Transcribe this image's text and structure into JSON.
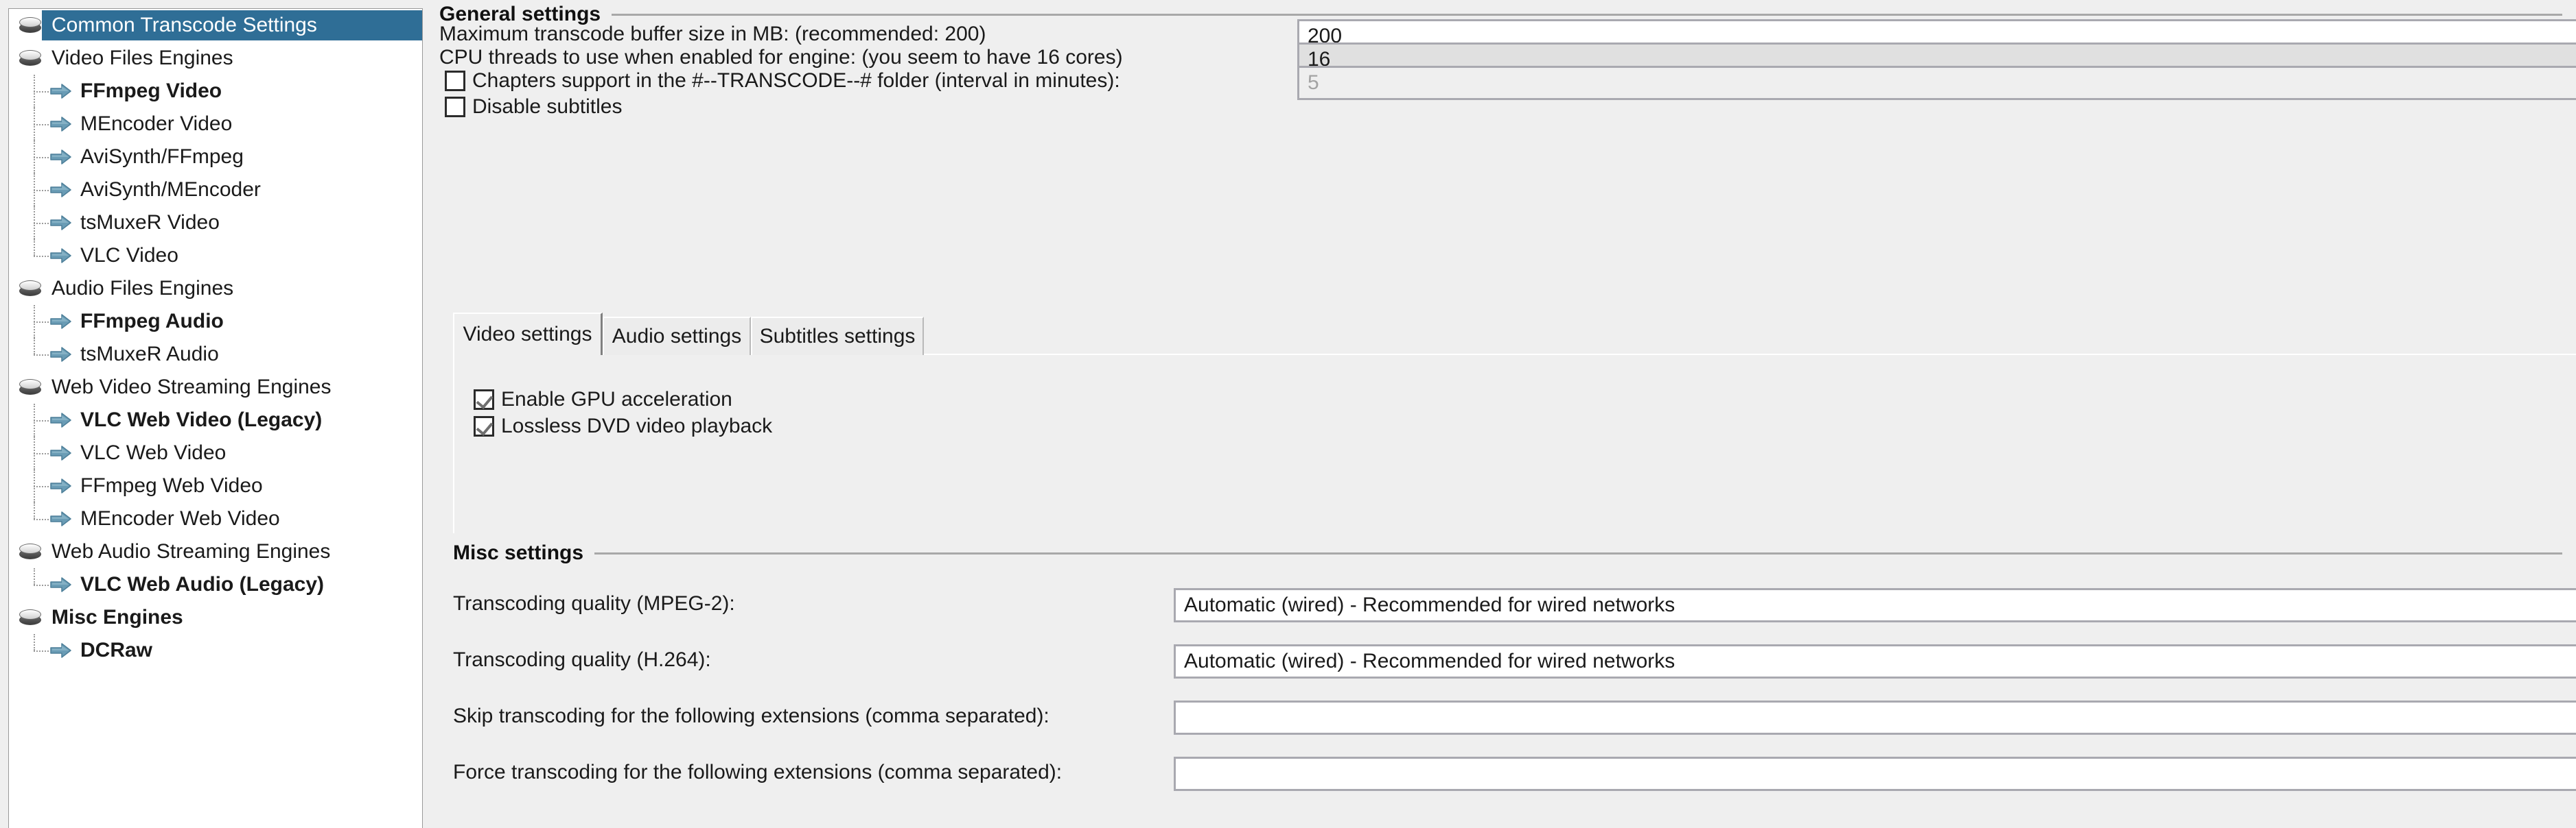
{
  "tree": {
    "items": [
      {
        "label": "Common Transcode Settings",
        "type": "category",
        "bold": false,
        "selected": true
      },
      {
        "label": "Video Files Engines",
        "type": "category",
        "bold": false,
        "selected": false
      },
      {
        "label": "FFmpeg Video",
        "type": "leaf",
        "bold": true,
        "selected": false
      },
      {
        "label": "MEncoder Video",
        "type": "leaf",
        "bold": false,
        "selected": false
      },
      {
        "label": "AviSynth/FFmpeg",
        "type": "leaf",
        "bold": false,
        "selected": false
      },
      {
        "label": "AviSynth/MEncoder",
        "type": "leaf",
        "bold": false,
        "selected": false
      },
      {
        "label": "tsMuxeR Video",
        "type": "leaf",
        "bold": false,
        "selected": false
      },
      {
        "label": "VLC Video",
        "type": "leaf",
        "bold": false,
        "selected": false
      },
      {
        "label": "Audio Files Engines",
        "type": "category",
        "bold": false,
        "selected": false
      },
      {
        "label": "FFmpeg Audio",
        "type": "leaf",
        "bold": true,
        "selected": false
      },
      {
        "label": "tsMuxeR Audio",
        "type": "leaf",
        "bold": false,
        "selected": false
      },
      {
        "label": "Web Video Streaming Engines",
        "type": "category",
        "bold": false,
        "selected": false
      },
      {
        "label": "VLC Web Video (Legacy)",
        "type": "leaf",
        "bold": true,
        "selected": false
      },
      {
        "label": "VLC Web Video",
        "type": "leaf",
        "bold": false,
        "selected": false
      },
      {
        "label": "FFmpeg Web Video",
        "type": "leaf",
        "bold": false,
        "selected": false
      },
      {
        "label": "MEncoder Web Video",
        "type": "leaf",
        "bold": false,
        "selected": false
      },
      {
        "label": "Web Audio Streaming Engines",
        "type": "category",
        "bold": false,
        "selected": false
      },
      {
        "label": "VLC Web Audio (Legacy)",
        "type": "leaf",
        "bold": true,
        "selected": false
      },
      {
        "label": "Misc Engines",
        "type": "category",
        "bold": true,
        "selected": false
      },
      {
        "label": "DCRaw",
        "type": "leaf",
        "bold": true,
        "selected": false
      }
    ],
    "icons": {
      "category": "disc-icon",
      "leaf": "blue-arrow-icon"
    }
  },
  "general": {
    "group_title": "General settings",
    "buffer_label": "Maximum transcode buffer size in MB: (recommended: 200)",
    "buffer_value": "200",
    "cpu_label": "CPU threads to use when enabled for engine: (you seem to have 16 cores)",
    "cpu_value": "16",
    "chapters_label": "Chapters support in the #--TRANSCODE--# folder (interval in minutes):",
    "chapters_checked": false,
    "chapters_interval": "5",
    "disable_subtitles_label": "Disable subtitles",
    "disable_subtitles_checked": false
  },
  "tabs": {
    "items": [
      {
        "label": "Video settings",
        "active": true
      },
      {
        "label": "Audio settings",
        "active": false
      },
      {
        "label": "Subtitles settings",
        "active": false
      }
    ]
  },
  "video_tab": {
    "gpu_label": "Enable GPU acceleration",
    "gpu_checked": true,
    "dvd_label": "Lossless DVD video playback",
    "dvd_checked": true
  },
  "misc": {
    "group_title": "Misc settings",
    "mpeg2_label": "Transcoding quality (MPEG-2):",
    "mpeg2_value": "Automatic (wired) - Recommended for wired networks",
    "h264_label": "Transcoding quality (H.264):",
    "h264_value": "Automatic (wired) - Recommended for wired networks",
    "skip_label": "Skip transcoding for the following extensions (comma separated):",
    "skip_value": "",
    "force_label": "Force transcoding for the following extensions (comma separated):",
    "force_value": ""
  },
  "colors": {
    "selection": "#2f6e96",
    "panel_bg": "#efefef",
    "field_border": "#a9a9b0",
    "arrow_icon": "#5a8da8"
  }
}
